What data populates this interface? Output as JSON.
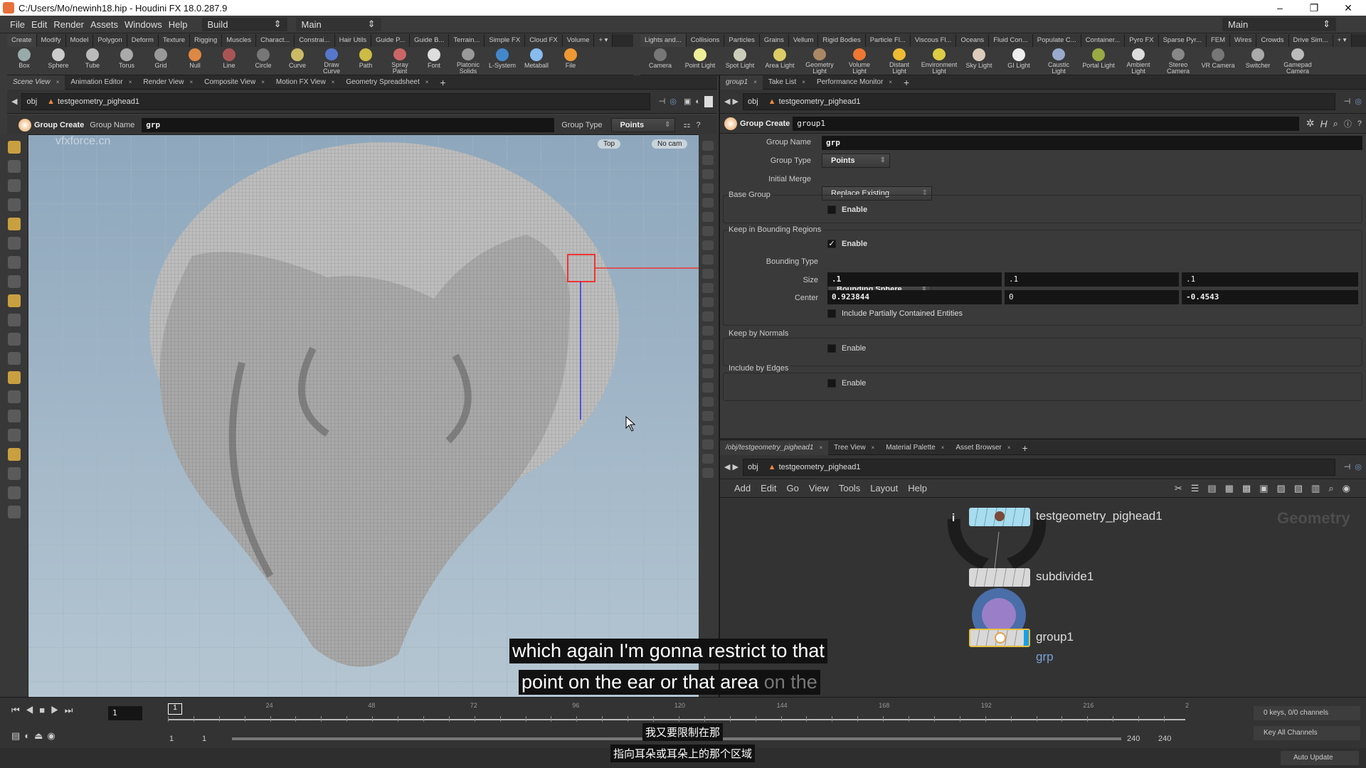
{
  "window": {
    "title": "C:/Users/Mo/newinh18.hip - Houdini FX 18.0.287.9",
    "controls": [
      "–",
      "❐",
      "✕"
    ]
  },
  "menubar": {
    "items": [
      "File",
      "Edit",
      "Render",
      "Assets",
      "Windows",
      "Help"
    ],
    "desktop": "Build",
    "desktop_right": "Main",
    "main_right": "Main"
  },
  "shelf_left": {
    "tabs": [
      "Create",
      "Modify",
      "Model",
      "Polygon",
      "Deform",
      "Texture",
      "Rigging",
      "Muscles",
      "Charact...",
      "Constrai...",
      "Hair Utils",
      "Guide P...",
      "Guide B...",
      "Terrain...",
      "Simple FX",
      "Cloud FX",
      "Volume"
    ],
    "tools": [
      {
        "label": "Box",
        "color": "#9aa"
      },
      {
        "label": "Sphere",
        "color": "#ccc"
      },
      {
        "label": "Tube",
        "color": "#bbb"
      },
      {
        "label": "Torus",
        "color": "#aaa"
      },
      {
        "label": "Grid",
        "color": "#999"
      },
      {
        "label": "Null",
        "color": "#d84"
      },
      {
        "label": "Line",
        "color": "#a55"
      },
      {
        "label": "Circle",
        "color": "#777"
      },
      {
        "label": "Curve",
        "color": "#cb6"
      },
      {
        "label": "Draw Curve",
        "color": "#57c"
      },
      {
        "label": "Path",
        "color": "#cb4"
      },
      {
        "label": "Spray Paint",
        "color": "#c66"
      },
      {
        "label": "Font",
        "color": "#ddd"
      },
      {
        "label": "Platonic Solids",
        "color": "#999"
      },
      {
        "label": "L-System",
        "color": "#48c"
      },
      {
        "label": "Metaball",
        "color": "#8be"
      },
      {
        "label": "File",
        "color": "#e93"
      }
    ]
  },
  "shelf_right": {
    "tabs": [
      "Lights and...",
      "Collisions",
      "Particles",
      "Grains",
      "Vellum",
      "Rigid Bodies",
      "Particle Fl...",
      "Viscous Fl...",
      "Oceans",
      "Fluid Con...",
      "Populate C...",
      "Container...",
      "Pyro FX",
      "Sparse Pyr...",
      "FEM",
      "Wires",
      "Crowds",
      "Drive Sim..."
    ],
    "tools": [
      {
        "label": "Camera",
        "color": "#777"
      },
      {
        "label": "Point Light",
        "color": "#ee9"
      },
      {
        "label": "Spot Light",
        "color": "#ccb"
      },
      {
        "label": "Area Light",
        "color": "#dc6"
      },
      {
        "label": "Geometry Light",
        "color": "#a86"
      },
      {
        "label": "Volume Light",
        "color": "#e73"
      },
      {
        "label": "Distant Light",
        "color": "#eb3"
      },
      {
        "label": "Environment Light",
        "color": "#dc4"
      },
      {
        "label": "Sky Light",
        "color": "#dcb"
      },
      {
        "label": "GI Light",
        "color": "#eee"
      },
      {
        "label": "Caustic Light",
        "color": "#9ac"
      },
      {
        "label": "Portal Light",
        "color": "#9a4"
      },
      {
        "label": "Ambient Light",
        "color": "#ddd"
      },
      {
        "label": "Stereo Camera",
        "color": "#888"
      },
      {
        "label": "VR Camera",
        "color": "#777"
      },
      {
        "label": "Switcher",
        "color": "#aaa"
      },
      {
        "label": "Gamepad Camera",
        "color": "#bbb"
      }
    ]
  },
  "left_pane": {
    "tabs": [
      "Scene View",
      "Animation Editor",
      "Render View",
      "Composite View",
      "Motion FX View",
      "Geometry Spreadsheet"
    ],
    "path": {
      "root": "obj",
      "node": "testgeometry_pighead1"
    },
    "op": {
      "name": "Group Create",
      "group_name_label": "Group Name",
      "group_name": "grp",
      "group_type_label": "Group Type",
      "group_type": "Points"
    },
    "viewport": {
      "watermark": "vfxforce.cn",
      "view": "Top",
      "camera": "No cam"
    }
  },
  "params": {
    "tabs": [
      "group1",
      "Take List",
      "Performance Monitor"
    ],
    "path": {
      "root": "obj",
      "node": "testgeometry_pighead1"
    },
    "node_type": "Group Create",
    "node_name": "group1",
    "group_name_label": "Group Name",
    "group_name": "grp",
    "group_type_label": "Group Type",
    "group_type": "Points",
    "initial_merge_label": "Initial Merge",
    "initial_merge": "Replace Existing",
    "base_group": {
      "title": "Base Group",
      "enable": "Enable",
      "checked": false
    },
    "bounding": {
      "title": "Keep in Bounding Regions",
      "enable": "Enable",
      "checked": true,
      "type_label": "Bounding Type",
      "type": "Bounding Sphere",
      "size_label": "Size",
      "size": [
        ".1",
        ".1",
        ".1"
      ],
      "center_label": "Center",
      "center": [
        "0.923844",
        "0",
        "-0.4543"
      ],
      "partial": "Include Partially Contained Entities",
      "partial_checked": false
    },
    "normals": {
      "title": "Keep by Normals",
      "enable": "Enable",
      "checked": false
    },
    "edges": {
      "title": "Include by Edges",
      "enable": "Enable",
      "checked": false
    }
  },
  "network": {
    "tabs": [
      "/obj/testgeometry_pighead1",
      "Tree View",
      "Material Palette",
      "Asset Browser"
    ],
    "path": {
      "root": "obj",
      "node": "testgeometry_pighead1"
    },
    "menu": [
      "Add",
      "Edit",
      "Go",
      "View",
      "Tools",
      "Layout",
      "Help"
    ],
    "context_label": "Geometry",
    "nodes": [
      {
        "name": "testgeometry_pighead1"
      },
      {
        "name": "subdivide1"
      },
      {
        "name": "group1",
        "group": "grp"
      }
    ]
  },
  "timeline": {
    "frame": "1",
    "ticks": [
      "24",
      "48",
      "72",
      "96",
      "120",
      "144",
      "168",
      "192",
      "216",
      "2"
    ],
    "current": "1",
    "start": "1",
    "start2": "1",
    "end": "240",
    "end2": "240",
    "keys": "0 keys, 0/0 channels",
    "key_all": "Key All Channels",
    "auto_update": "Auto Update"
  },
  "subtitles": {
    "en1": "which again I'm gonna restrict to that",
    "en2a": "point on the ear or that area",
    "en2b": " on the",
    "zh1": "我又要限制在那",
    "zh2": "指向耳朵或耳朵上的那个区域"
  }
}
